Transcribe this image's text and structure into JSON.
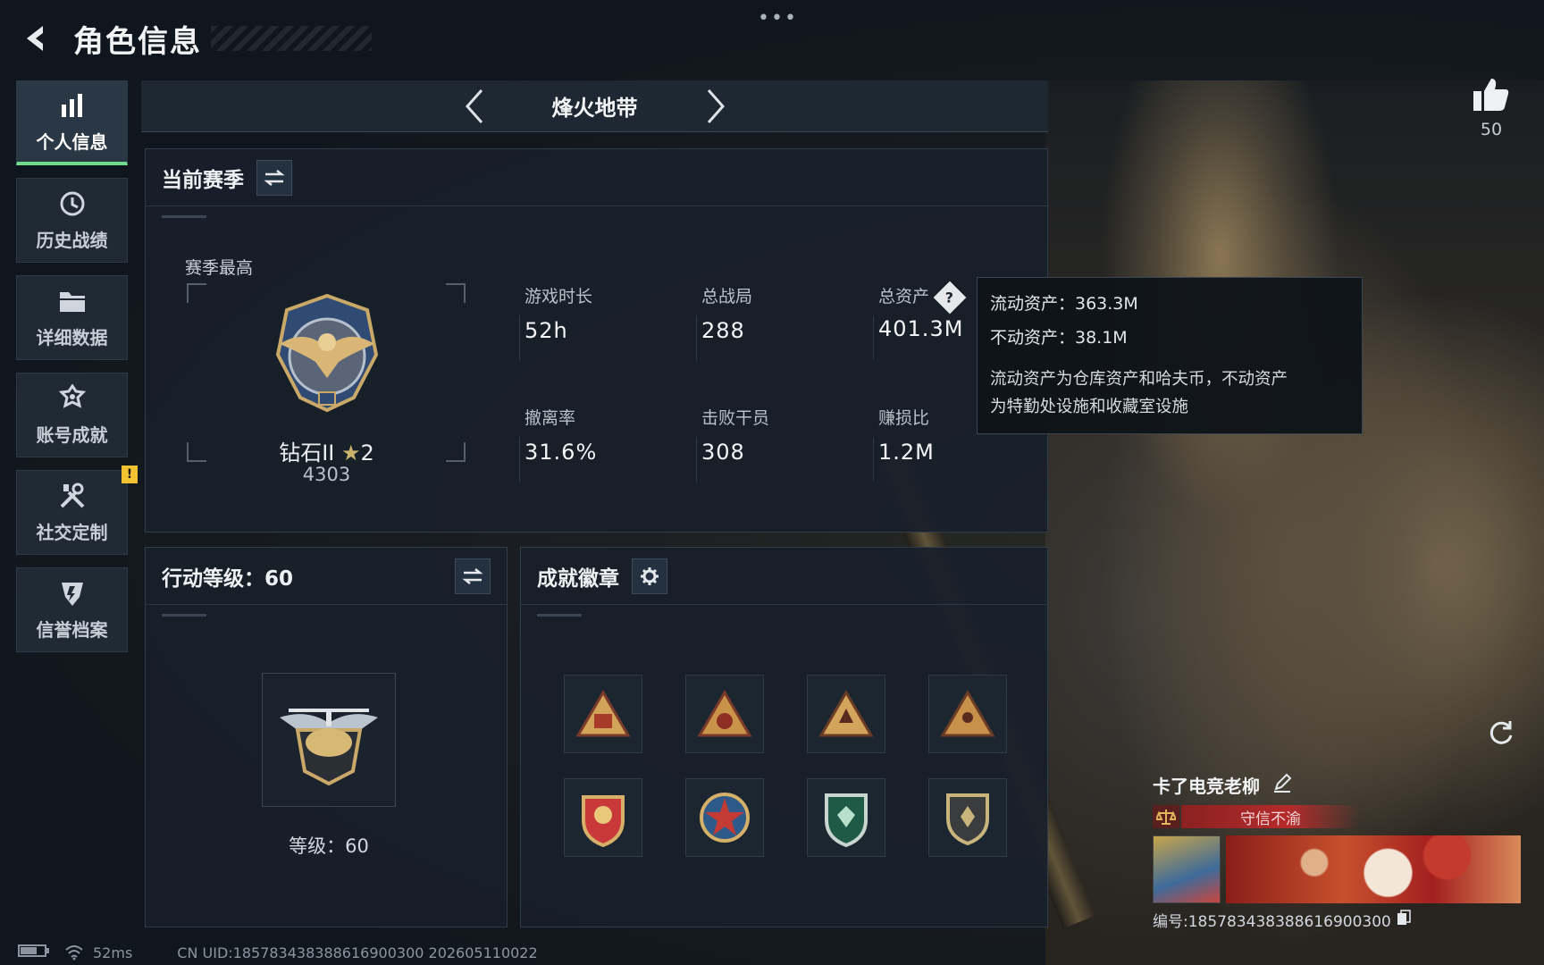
{
  "header": {
    "title": "角色信息"
  },
  "sidebar": {
    "items": [
      {
        "label": "个人信息",
        "icon": "bar-chart-icon",
        "active": true
      },
      {
        "label": "历史战绩",
        "icon": "history-icon"
      },
      {
        "label": "详细数据",
        "icon": "folder-icon"
      },
      {
        "label": "账号成就",
        "icon": "achievement-icon"
      },
      {
        "label": "社交定制",
        "icon": "tools-icon",
        "badge": "!"
      },
      {
        "label": "信誉档案",
        "icon": "shield-icon"
      }
    ]
  },
  "mode": {
    "label": "烽火地带"
  },
  "season": {
    "title": "当前赛季",
    "best_label": "赛季最高",
    "rank_name": "钻石II",
    "rank_stars": "2",
    "rank_points": "4303",
    "stats": [
      {
        "label": "游戏时长",
        "value": "52h"
      },
      {
        "label": "总战局",
        "value": "288"
      },
      {
        "label": "总资产",
        "value": "401.3M"
      },
      {
        "label": "撤离率",
        "value": "31.6%"
      },
      {
        "label": "击败干员",
        "value": "308"
      },
      {
        "label": "赚损比",
        "value": "1.2M"
      }
    ]
  },
  "tooltip": {
    "liquid": "流动资产：363.3M",
    "fixed": "不动资产：38.1M",
    "desc_line1": "流动资产为仓库资产和哈夫币，不动资产",
    "desc_line2": "为特勤处设施和收藏室设施"
  },
  "action_level": {
    "title": "行动等级：60",
    "level_text": "等级：60"
  },
  "achievements": {
    "title": "成就徽章"
  },
  "likes": {
    "count": "50"
  },
  "player": {
    "name": "卡了电竞老柳",
    "honor": "守信不渝",
    "uid": "编号:185783438388616900300"
  },
  "footer": {
    "ping": "52ms",
    "uid": "CN UID:185783438388616900300 202605110022"
  },
  "colors": {
    "accent_green": "#6fdc8c",
    "warning_yellow": "#f2c230",
    "honor_red": "#b52b2b"
  }
}
